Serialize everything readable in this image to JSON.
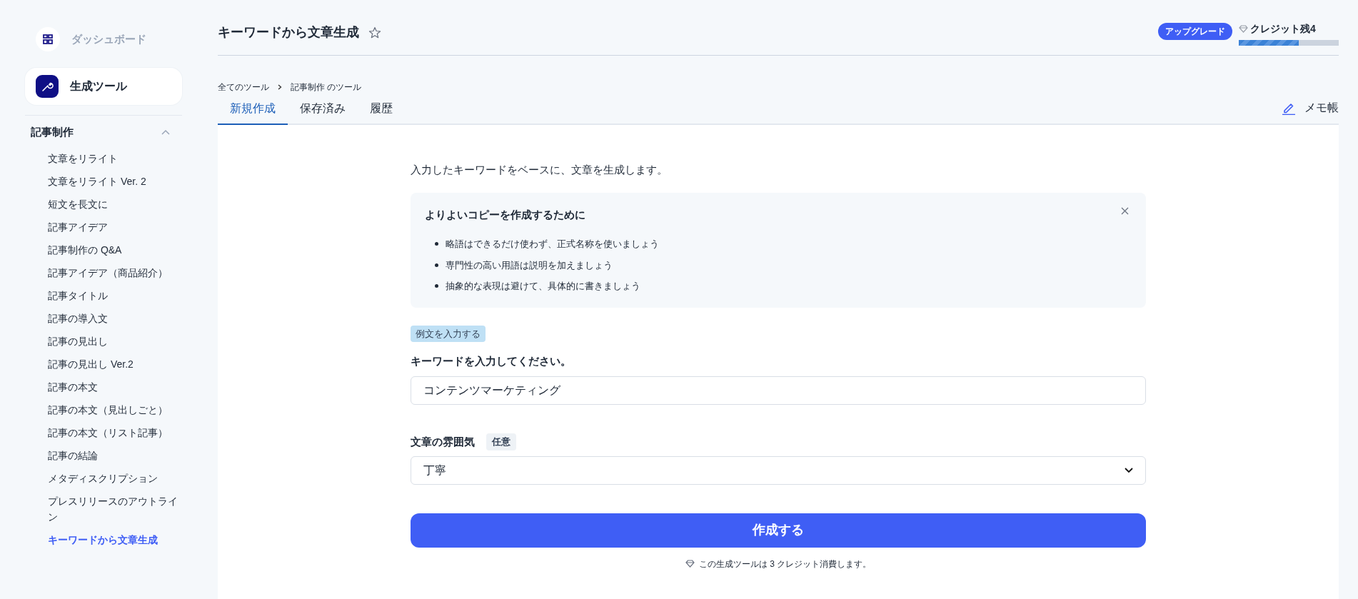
{
  "sidebar": {
    "dashboard": {
      "label": "ダッシュボード"
    },
    "tools": {
      "label": "生成ツール",
      "selected": true
    },
    "section": {
      "title": "記事制作",
      "expanded": true,
      "items": [
        {
          "label": "文章をリライト",
          "selected": false
        },
        {
          "label": "文章をリライト Ver. 2",
          "selected": false
        },
        {
          "label": "短文を長文に",
          "selected": false
        },
        {
          "label": "記事アイデア",
          "selected": false
        },
        {
          "label": "記事制作の Q&A",
          "selected": false
        },
        {
          "label": "記事アイデア（商品紹介）",
          "selected": false
        },
        {
          "label": "記事タイトル",
          "selected": false
        },
        {
          "label": "記事の導入文",
          "selected": false
        },
        {
          "label": "記事の見出し",
          "selected": false
        },
        {
          "label": "記事の見出し Ver.2",
          "selected": false
        },
        {
          "label": "記事の本文",
          "selected": false
        },
        {
          "label": "記事の本文（見出しごと）",
          "selected": false
        },
        {
          "label": "記事の本文（リスト記事）",
          "selected": false
        },
        {
          "label": "記事の結論",
          "selected": false
        },
        {
          "label": "メタディスクリプション",
          "selected": false
        },
        {
          "label": "プレスリリースのアウトライン",
          "selected": false
        },
        {
          "label": "キーワードから文章生成",
          "selected": true
        }
      ]
    }
  },
  "header": {
    "title": "キーワードから文章生成",
    "starred": false,
    "upgrade": "アップグレード",
    "credits": "クレジット残4",
    "credit_bar": {
      "level": 0.6
    }
  },
  "breadcrumb": [
    "全てのツール",
    "記事制作 のツール"
  ],
  "tabs": [
    {
      "label": "新規作成",
      "selected": true
    },
    {
      "label": "保存済み",
      "selected": false
    },
    {
      "label": "履歴",
      "selected": false
    }
  ],
  "memo": "メモ帳",
  "form": {
    "description": "入力したキーワードをベースに、文章を生成します。",
    "tips": {
      "title": "よりよいコピーを作成するために",
      "items": [
        "略語はできるだけ使わず、正式名称を使いましょう",
        "専門性の高い用語は説明を加えましょう",
        "抽象的な表現は避けて、具体的に書きましょう"
      ]
    },
    "example_button": "例文を入力する",
    "keyword": {
      "label": "キーワードを入力してください。",
      "value": "コンテンツマーケティング"
    },
    "tone": {
      "label": "文章の雰囲気",
      "badge": "任意",
      "value": "丁寧"
    },
    "submit": "作成する",
    "note": "この生成ツールは 3 クレジット消費します。"
  }
}
